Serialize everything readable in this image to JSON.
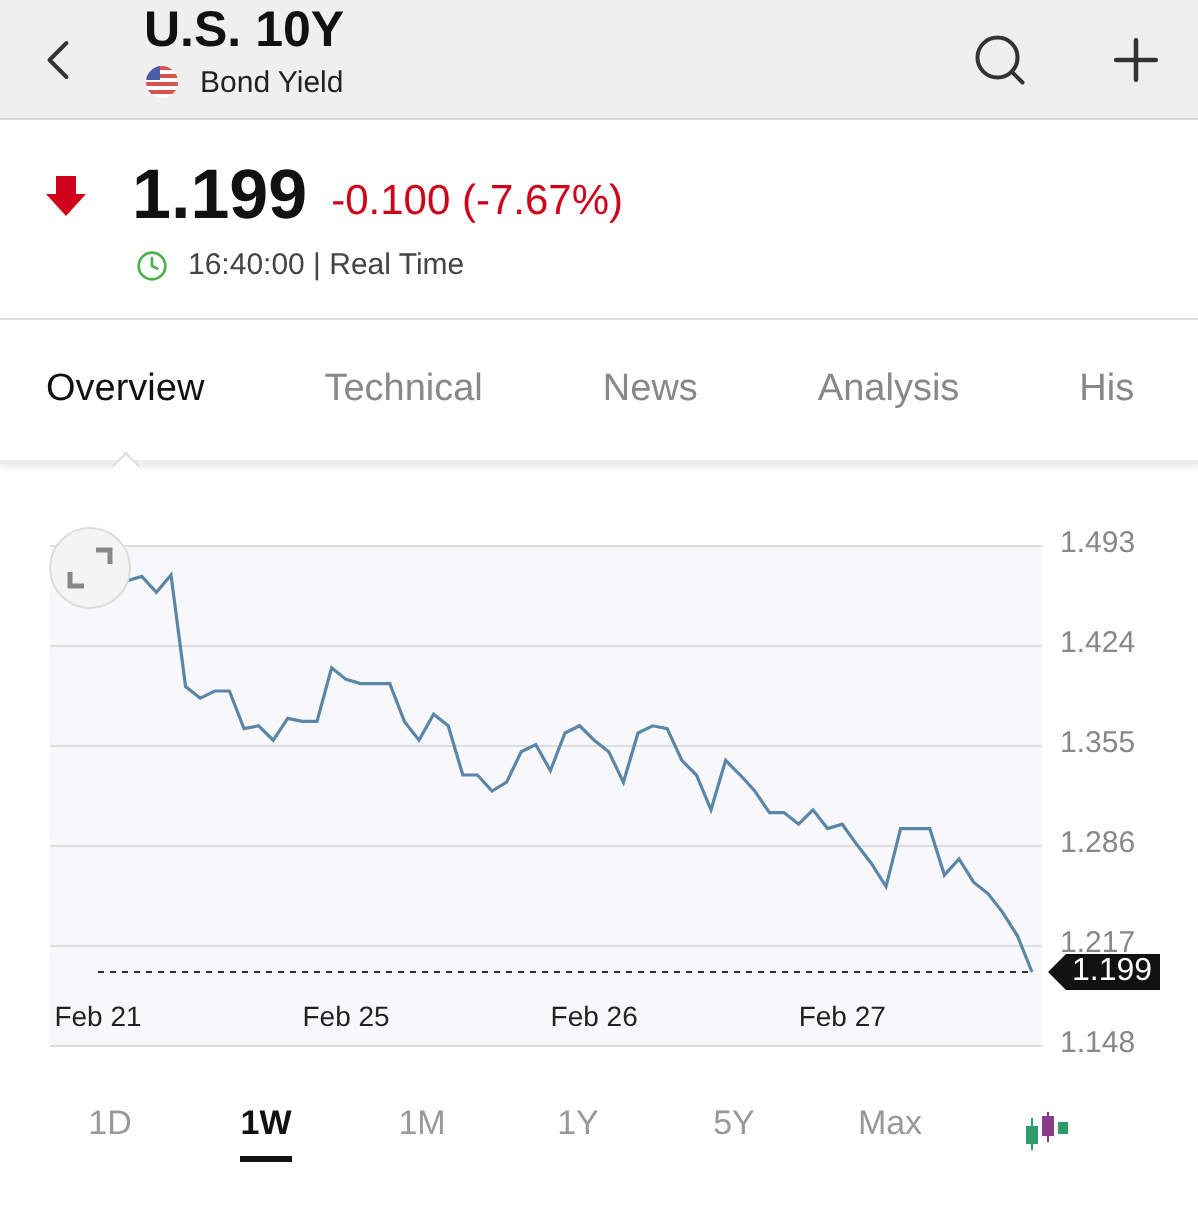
{
  "header": {
    "title": "U.S. 10Y",
    "subtitle": "Bond Yield"
  },
  "quote": {
    "price": "1.199",
    "change": "-0.100 (-7.67%)",
    "falling": true,
    "time": "16:40:00 | Real Time"
  },
  "tabs": [
    {
      "label": "Overview",
      "selected": true
    },
    {
      "label": "Technical",
      "selected": false
    },
    {
      "label": "News",
      "selected": false
    },
    {
      "label": "Analysis",
      "selected": false
    },
    {
      "label": "His",
      "selected": false
    }
  ],
  "chart": {
    "price_tag": "1.199",
    "chart_data": {
      "type": "line",
      "grid": true,
      "categories": [
        "Feb 21",
        null,
        null,
        null,
        null,
        null,
        null,
        null,
        null,
        null,
        null,
        null,
        null,
        null,
        null,
        null,
        null,
        "Feb 25",
        null,
        null,
        null,
        null,
        null,
        null,
        null,
        null,
        null,
        null,
        null,
        null,
        null,
        null,
        null,
        null,
        "Feb 26",
        null,
        null,
        null,
        null,
        null,
        null,
        null,
        null,
        null,
        null,
        null,
        null,
        null,
        null,
        null,
        null,
        "Feb 27",
        null,
        null,
        null,
        null,
        null,
        null,
        null,
        null,
        null,
        null,
        null,
        null,
        null
      ],
      "ylim": [
        1.148,
        1.493
      ],
      "yticks": [
        {
          "value": 1.493,
          "label": "1.493"
        },
        {
          "value": 1.424,
          "label": "1.424"
        },
        {
          "value": 1.355,
          "label": "1.355"
        },
        {
          "value": 1.286,
          "label": "1.286"
        },
        {
          "value": 1.217,
          "label": "1.217"
        },
        {
          "value": 1.148,
          "label": "1.148"
        }
      ],
      "series": [
        {
          "color": "#5b86a8",
          "values": [
            null,
            null,
            1.469,
            1.472,
            1.461,
            1.473,
            1.396,
            1.388,
            1.393,
            1.393,
            1.367,
            1.369,
            1.359,
            1.374,
            1.372,
            1.372,
            1.409,
            1.401,
            1.398,
            1.398,
            1.398,
            1.372,
            1.359,
            1.377,
            1.369,
            1.335,
            1.335,
            1.324,
            1.33,
            1.351,
            1.356,
            1.338,
            1.364,
            1.369,
            1.359,
            1.351,
            1.33,
            1.364,
            1.369,
            1.367,
            1.345,
            1.335,
            1.311,
            1.345,
            1.335,
            1.324,
            1.309,
            1.309,
            1.301,
            1.311,
            1.298,
            1.301,
            1.287,
            1.274,
            1.258,
            1.298,
            1.298,
            1.298,
            1.266,
            1.277,
            1.261,
            1.253,
            1.24,
            1.224,
            1.199
          ]
        },
        {
          "color": "#333333",
          "line_style": "dashed",
          "values": [
            1.199,
            1.199,
            1.199,
            1.199,
            1.199,
            1.199,
            1.199,
            1.199,
            1.199,
            1.199,
            1.199,
            1.199,
            1.199,
            1.199,
            1.199,
            1.199,
            1.199,
            1.199,
            1.199,
            1.199,
            1.199,
            1.199,
            1.199,
            1.199,
            1.199,
            1.199,
            1.199,
            1.199,
            1.199,
            1.199,
            1.199,
            1.199,
            1.199,
            1.199,
            1.199,
            1.199,
            1.199,
            1.199,
            1.199,
            1.199,
            1.199,
            1.199,
            1.199,
            1.199,
            1.199,
            1.199,
            1.199,
            1.199,
            1.199,
            1.199,
            1.199,
            1.199,
            1.199,
            1.199,
            1.199,
            1.199,
            1.199,
            1.199,
            1.199,
            1.199,
            1.199,
            1.199,
            1.199,
            1.199,
            1.199
          ]
        }
      ]
    }
  },
  "ranges": [
    {
      "label": "1D",
      "selected": false
    },
    {
      "label": "1W",
      "selected": true
    },
    {
      "label": "1M",
      "selected": false
    },
    {
      "label": "1Y",
      "selected": false
    },
    {
      "label": "5Y",
      "selected": false
    },
    {
      "label": "Max",
      "selected": false
    }
  ]
}
